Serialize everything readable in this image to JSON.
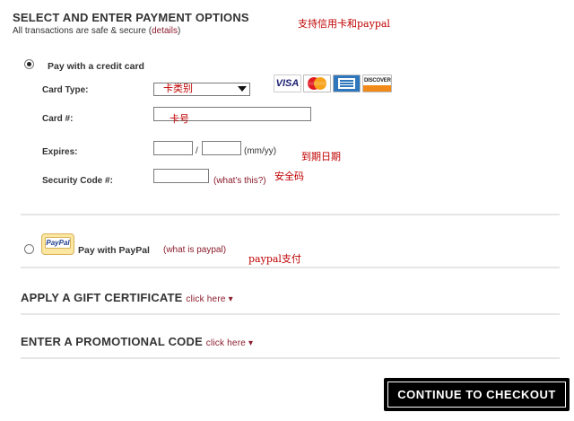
{
  "header": {
    "title": "SELECT AND ENTER PAYMENT OPTIONS",
    "subtitle": "All transactions are safe & secure (",
    "details_link": "details",
    "subtitle_end": ")",
    "note": "支持信用卡和paypal"
  },
  "credit_card": {
    "option_label": "Pay with a credit card",
    "selected": true,
    "card_type_label": "Card Type:",
    "card_type_value": "卡类别",
    "card_number_label": "Card #:",
    "card_number_note": "卡号",
    "expires_label": "Expires:",
    "expires_separator": "/",
    "expires_format": "(mm/yy)",
    "expires_note": "到期日期",
    "security_label": "Security Code #:",
    "security_help": "(what's this?)",
    "security_note": "安全码",
    "card_logos": [
      "VISA",
      "MasterCard",
      "AMEX",
      "DISCOVER"
    ]
  },
  "paypal": {
    "logo_text": "PayPal",
    "option_label": "Pay with PayPal",
    "help_link": "(what is paypal)",
    "note": "paypal支付",
    "selected": false
  },
  "gift": {
    "title": "APPLY A GIFT CERTIFICATE",
    "link": "click here ▾"
  },
  "promo": {
    "title": "ENTER A PROMOTIONAL CODE",
    "link": "click here ▾"
  },
  "checkout_button": "CONTINUE TO CHECKOUT",
  "colors": {
    "link": "#8a1c2b",
    "note": "#c00000",
    "button_bg": "#000000"
  }
}
